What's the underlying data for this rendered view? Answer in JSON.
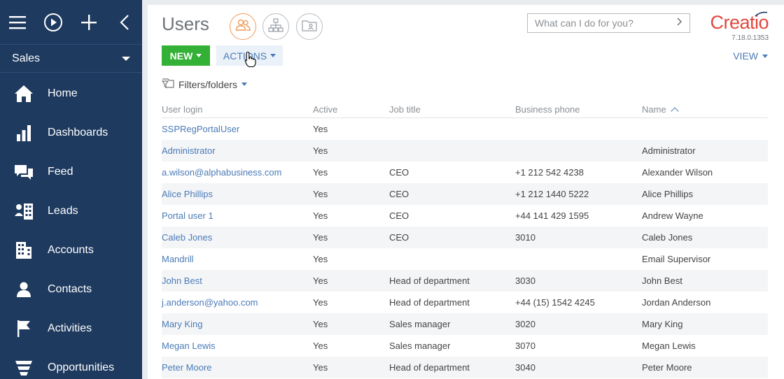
{
  "sidebar": {
    "section": "Sales",
    "items": [
      {
        "label": "Home",
        "icon": "home-icon"
      },
      {
        "label": "Dashboards",
        "icon": "dashboards-icon"
      },
      {
        "label": "Feed",
        "icon": "feed-icon"
      },
      {
        "label": "Leads",
        "icon": "leads-icon"
      },
      {
        "label": "Accounts",
        "icon": "accounts-icon"
      },
      {
        "label": "Contacts",
        "icon": "contacts-icon"
      },
      {
        "label": "Activities",
        "icon": "activities-icon"
      },
      {
        "label": "Opportunities",
        "icon": "opportunities-icon"
      }
    ]
  },
  "header": {
    "title": "Users",
    "command_placeholder": "What can I do for you?",
    "logo_text": "Creatio",
    "version": "7.18.0.1353"
  },
  "toolbar": {
    "new_label": "NEW",
    "actions_label": "ACTIONS",
    "view_label": "VIEW",
    "filters_label": "Filters/folders"
  },
  "grid": {
    "columns": [
      "User login",
      "Active",
      "Job title",
      "Business phone",
      "Name"
    ],
    "rows": [
      [
        "SSPRegPortalUser",
        "Yes",
        "",
        "",
        ""
      ],
      [
        "Administrator",
        "Yes",
        "",
        "",
        "Administrator"
      ],
      [
        "a.wilson@alphabusiness.com",
        "Yes",
        "CEO",
        "+1 212 542 4238",
        "Alexander Wilson"
      ],
      [
        "Alice Phillips",
        "Yes",
        "CEO",
        "+1 212 1440 5222",
        "Alice Phillips"
      ],
      [
        "Portal user 1",
        "Yes",
        "CEO",
        "+44 141 429 1595",
        "Andrew Wayne"
      ],
      [
        "Caleb Jones",
        "Yes",
        "CEO",
        "3010",
        "Caleb Jones"
      ],
      [
        "Mandrill",
        "Yes",
        "",
        "",
        "Email Supervisor"
      ],
      [
        "John Best",
        "Yes",
        "Head of department",
        "3030",
        "John Best"
      ],
      [
        "j.anderson@yahoo.com",
        "Yes",
        "Head of department",
        "+44 (15) 1542 4245",
        "Jordan Anderson"
      ],
      [
        "Mary King",
        "Yes",
        "Sales manager",
        "3020",
        "Mary King"
      ],
      [
        "Megan Lewis",
        "Yes",
        "Sales manager",
        "3070",
        "Megan Lewis"
      ],
      [
        "Peter Moore",
        "Yes",
        "Head of department",
        "3040",
        "Peter Moore"
      ]
    ]
  },
  "colors": {
    "sidebar_bg": "#1e3a5f",
    "new_button": "#33b036",
    "link": "#4a7bb7",
    "brand": "#e2483e",
    "accent_orange": "#f29a58"
  }
}
